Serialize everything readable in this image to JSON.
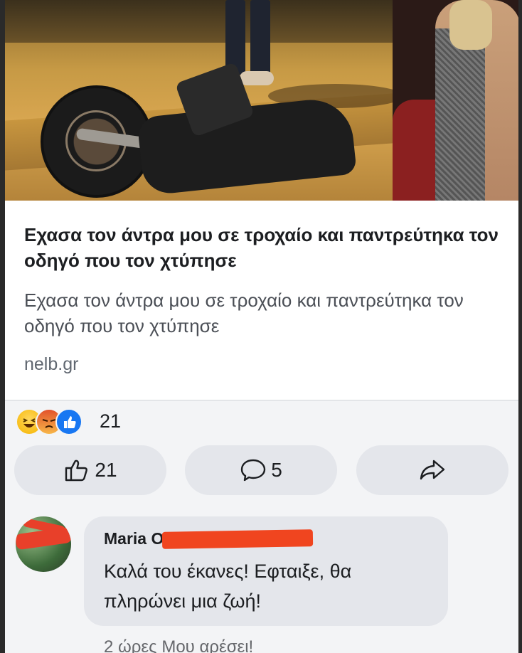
{
  "post": {
    "link_title": "Εχασα τον άντρα μου σε τροχαίο και παντρεύτηκα τον οδηγό που τον χτύπησε",
    "link_description": "Εχασα τον άντρα μου σε τροχαίο και παντρεύτηκα τον οδηγό που τον χτύπησε",
    "link_domain": "nelb.gr",
    "reaction_icons": [
      "haha-emoji",
      "angry-emoji",
      "like-emoji"
    ],
    "reaction_count": "21"
  },
  "actions": {
    "like_count": "21",
    "comment_count": "5"
  },
  "comment": {
    "author": "Maria O",
    "text": "Καλά του έκανες! Εφταιξε, θα πληρώνει μια ζωή!",
    "meta": "2 ώρες    Μου αρέσει!"
  },
  "colors": {
    "pill_bg": "#e4e6eb",
    "like_blue": "#1877f2",
    "redaction": "#f0451f"
  }
}
